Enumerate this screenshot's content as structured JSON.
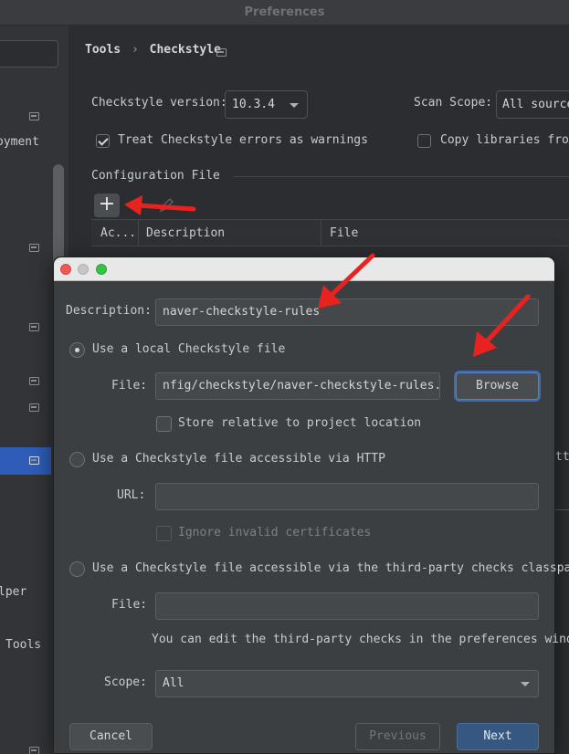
{
  "window": {
    "title": "Preferences"
  },
  "sidebar": {
    "items": [
      {
        "label": "oyment"
      },
      {
        "label": "lper"
      },
      {
        "label": "Tools"
      }
    ]
  },
  "breadcrumb": {
    "parent": "Tools",
    "separator": "›",
    "current": "Checkstyle"
  },
  "settings": {
    "version_label": "Checkstyle version:",
    "version_value": "10.3.4",
    "scope_label": "Scan Scope:",
    "scope_value": "All sources",
    "treat_errors_label": "Treat Checkstyle errors as warnings",
    "treat_errors_checked": true,
    "copy_libraries_label": "Copy libraries from p",
    "copy_libraries_checked": false,
    "config_section_label": "Configuration File",
    "add_icon_glyph": "+",
    "table": {
      "columns": [
        "Ac...",
        "Description",
        "File"
      ]
    },
    "partial_right_text": "tti"
  },
  "dialog": {
    "description_label": "Description:",
    "description_value": "naver-checkstyle-rules",
    "option_local_label": "Use a local Checkstyle file",
    "file_label": "File:",
    "file_value": "nfig/checkstyle/naver-checkstyle-rules.xml",
    "browse_label": "Browse",
    "store_relative_label": "Store relative to project location",
    "option_http_label": "Use a Checkstyle file accessible via HTTP",
    "url_label": "URL:",
    "url_value": "",
    "ignore_certs_label": "Ignore invalid certificates",
    "option_classpath_label": "Use a Checkstyle file accessible via the third-party checks classpath",
    "file2_label": "File:",
    "file2_value": "",
    "hint_text": "You can edit the third-party checks in the preferences window",
    "scope_label": "Scope:",
    "scope_value": "All",
    "cancel_label": "Cancel",
    "previous_label": "Previous",
    "next_label": "Next"
  },
  "colors": {
    "annotation_arrow": "#e8231f",
    "selection": "#2e5cb8",
    "primary_button": "#365880"
  }
}
